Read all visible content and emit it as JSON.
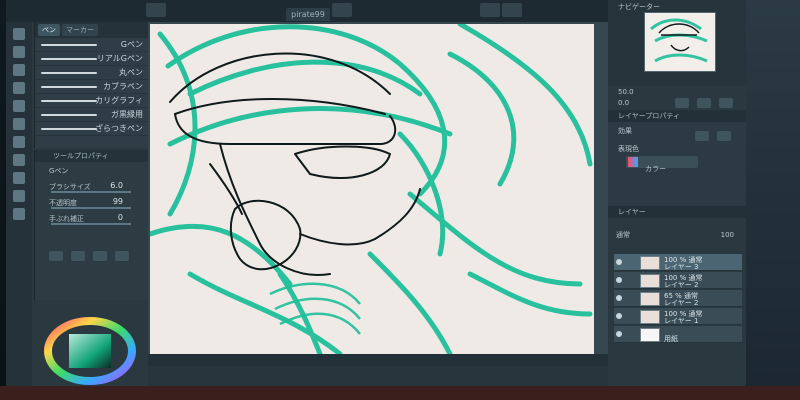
{
  "app": {
    "document_tab": "pirate99"
  },
  "tool_palette": {
    "tabs": [
      "ペン",
      "マーカー"
    ],
    "brushes": [
      {
        "label": "Gペン"
      },
      {
        "label": "リアルGペン"
      },
      {
        "label": "丸ペン"
      },
      {
        "label": "カブラペン"
      },
      {
        "label": "カリグラフィ"
      },
      {
        "label": "ガ黒縁用"
      },
      {
        "label": "ざらつきペン"
      }
    ]
  },
  "tool_property": {
    "title": "ツールプロパティ",
    "brush_name": "Gペン",
    "brush_size_label": "ブラシサイズ",
    "brush_size_value": "6.0",
    "opacity_label": "不透明度",
    "opacity_value": "99",
    "correction_label": "手ぶれ補正",
    "correction_value": "0"
  },
  "navigator": {
    "title": "ナビゲーター",
    "zoom_value": "50.0",
    "angle_value": "0.0"
  },
  "layer_property": {
    "title": "レイヤープロパティ",
    "effect_label": "効果",
    "expression_color_label": "表現色",
    "expression_color_value": "カラー"
  },
  "layer_panel": {
    "title": "レイヤー",
    "blend_mode": "通常",
    "opacity": "100",
    "layers": [
      {
        "name1": "100 % 通常",
        "name2": "レイヤー 3"
      },
      {
        "name1": "100 % 通常",
        "name2": "レイヤー 2"
      },
      {
        "name1": "65 % 通常",
        "name2": "レイヤー 2"
      },
      {
        "name1": "100 % 通常",
        "name2": "レイヤー 1"
      },
      {
        "name1": "",
        "name2": "用紙"
      }
    ]
  },
  "colors": {
    "sketch_green": "#1fbf9a",
    "ink": "#0f1a1a",
    "paper": "#efeae6"
  }
}
